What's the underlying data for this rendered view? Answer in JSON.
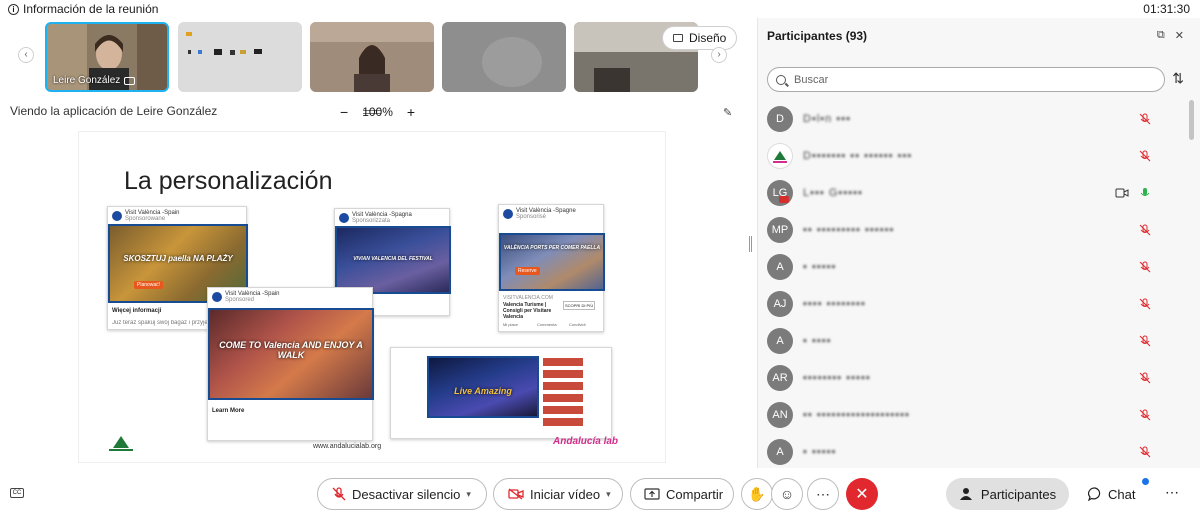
{
  "topbar": {
    "meeting_info_label": "Información de la reunión",
    "timer": "01:31:30"
  },
  "strip": {
    "tiles": [
      {
        "label": "Leire González",
        "active": true
      },
      {
        "label": "",
        "active": false
      },
      {
        "label": "",
        "active": false
      },
      {
        "label": "",
        "active": false
      },
      {
        "label": "",
        "active": false
      }
    ],
    "layout_label": "Diseño"
  },
  "share": {
    "viewing_label": "Viendo la aplicación de Leire González",
    "zoom_minus": "−",
    "zoom_level": "100%",
    "zoom_plus": "+"
  },
  "slide": {
    "title": "La personalización",
    "footer_url": "www.andalucialab.org",
    "brand": "Andalucía lab",
    "cards": [
      {
        "page": "Visit València -Spain",
        "sub": "Sponsorowane",
        "image_text": "SKOSZTUJ paella NA PLAŻY",
        "cta": "Planować!",
        "foot": "Więcej informacji",
        "caption": "Już teraz spakuj swój bagaż i przyjedź do Walencji"
      },
      {
        "page": "Visit València -Spagna",
        "sub": "Sponsorizzata",
        "image_text": "VIVIAN VALENCIA DEL FESTIVAL"
      },
      {
        "page": "Visit València -Spagne",
        "sub": "Sponsorisé",
        "image_text": "VALÈNCIA PORTS PER COMER PAELLA",
        "cta": "Reserve",
        "site": "VISITVALENCIA.COM",
        "desc": "Valencia Turisme | Consigli per Visitare Valencia",
        "cta2": "SCOPRI DI PIÙ",
        "actions": [
          "Mi piace",
          "Commenta",
          "Condividi"
        ]
      },
      {
        "page": "Visit València -Spain",
        "sub": "Sponsored",
        "image_text": "COME TO Valencia AND ENJOY A WALK",
        "foot": "Learn More"
      },
      {
        "page": "",
        "sub": "",
        "image_text": "Live Amazing"
      }
    ]
  },
  "panel": {
    "title": "Participantes (93)",
    "search_placeholder": "Buscar",
    "participants": [
      {
        "initials": "D",
        "name": "D▪l▪n ▪▪▪",
        "video": false
      },
      {
        "initials": "",
        "name": "D▪▪▪▪▪▪▪ ▪▪ ▪▪▪▪▪▪ ▪▪▪",
        "video": false
      },
      {
        "initials": "LG",
        "name": "L▪▪▪ G▪▪▪▪▪",
        "video": true
      },
      {
        "initials": "MP",
        "name": "▪▪ ▪▪▪▪▪▪▪▪▪ ▪▪▪▪▪▪",
        "video": false
      },
      {
        "initials": "A",
        "name": "▪ ▪▪▪▪▪",
        "video": false
      },
      {
        "initials": "AJ",
        "name": "▪▪▪▪ ▪▪▪▪▪▪▪▪",
        "video": false
      },
      {
        "initials": "A",
        "name": "▪ ▪▪▪▪",
        "video": false
      },
      {
        "initials": "AR",
        "name": "▪▪▪▪▪▪▪▪ ▪▪▪▪▪",
        "video": false
      },
      {
        "initials": "AN",
        "name": "▪▪ ▪▪▪▪▪▪▪▪▪▪▪▪▪▪▪▪▪▪▪",
        "video": false
      },
      {
        "initials": "A",
        "name": "▪ ▪▪▪▪▪",
        "video": false
      }
    ]
  },
  "toolbar": {
    "mute_label": "Desactivar silencio",
    "video_label": "Iniciar vídeo",
    "share_label": "Compartir",
    "participants_label": "Participantes",
    "chat_label": "Chat"
  },
  "colors": {
    "accent": "#1fb2f0",
    "end_call": "#e0282e",
    "muted_icon": "#e0282e",
    "active_speaker": "#2bb24c"
  }
}
